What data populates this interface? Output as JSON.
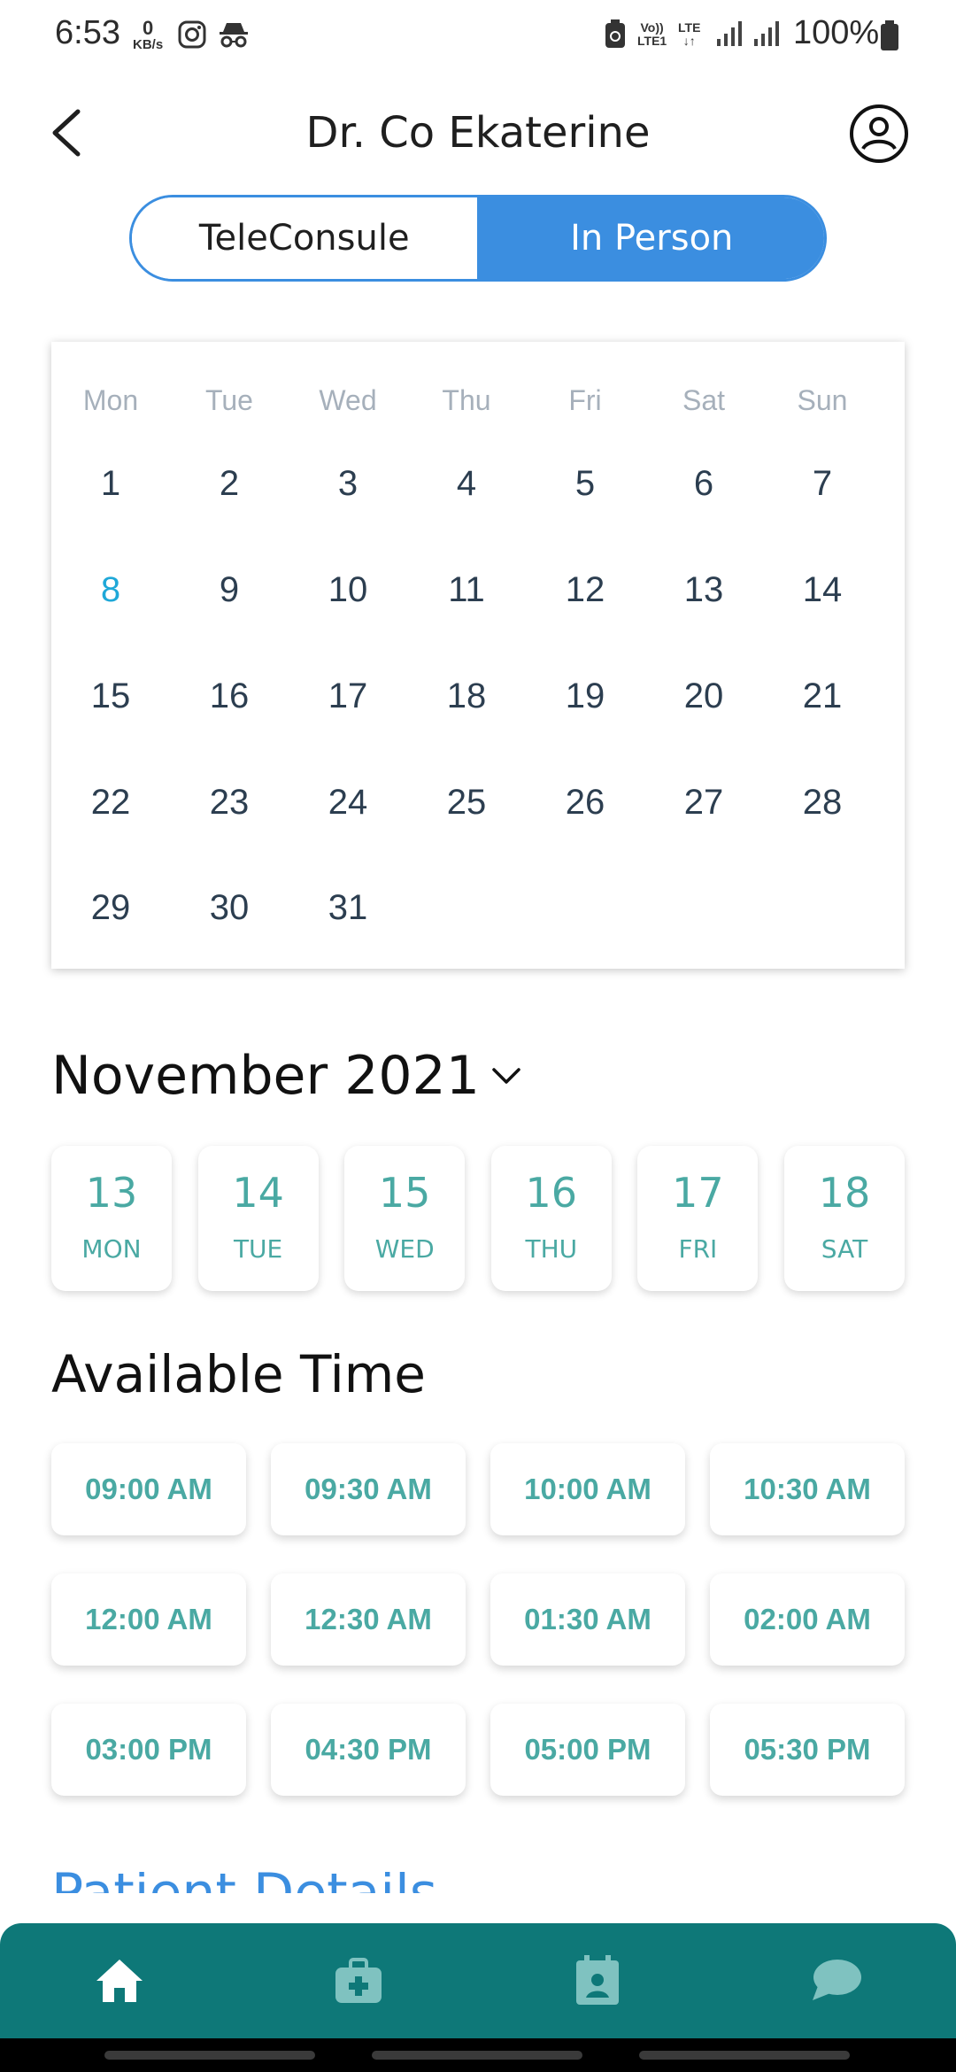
{
  "status_bar": {
    "time": "6:53",
    "kbs_value": "0",
    "kbs_unit": "KB/s",
    "volte": "Vo))",
    "lte1": "LTE1",
    "lte": "LTE",
    "battery": "100%"
  },
  "header": {
    "title": "Dr. Co Ekaterine",
    "back_icon": "chevron-left-icon",
    "profile_icon": "user-circle-icon"
  },
  "consult_toggle": {
    "options": [
      "TeleConsule",
      "In Person"
    ],
    "selected": "In Person"
  },
  "calendar": {
    "weekdays": [
      "Mon",
      "Tue",
      "Wed",
      "Thu",
      "Fri",
      "Sat",
      "Sun"
    ],
    "weeks": [
      [
        "1",
        "2",
        "3",
        "4",
        "5",
        "6",
        "7"
      ],
      [
        "8",
        "9",
        "10",
        "11",
        "12",
        "13",
        "14"
      ],
      [
        "15",
        "16",
        "17",
        "18",
        "19",
        "20",
        "21"
      ],
      [
        "22",
        "23",
        "24",
        "25",
        "26",
        "27",
        "28"
      ],
      [
        "29",
        "30",
        "31",
        "",
        "",
        "",
        ""
      ]
    ],
    "highlighted_day": "8",
    "highlight_color": "#1fa8d8"
  },
  "month_selector": {
    "label": "November 2021",
    "icon": "chevron-down-icon"
  },
  "week_strip": [
    {
      "day": "13",
      "dow": "MON"
    },
    {
      "day": "14",
      "dow": "TUE"
    },
    {
      "day": "15",
      "dow": "WED"
    },
    {
      "day": "16",
      "dow": "THU"
    },
    {
      "day": "17",
      "dow": "FRI"
    },
    {
      "day": "18",
      "dow": "SAT"
    }
  ],
  "available_time": {
    "title": "Available Time",
    "slots": [
      "09:00 AM",
      "09:30 AM",
      "10:00 AM",
      "10:30 AM",
      "12:00 AM",
      "12:30 AM",
      "01:30 AM",
      "02:00 AM",
      "03:00 PM",
      "04:30 PM",
      "05:00 PM",
      "05:30 PM"
    ]
  },
  "patient_details": {
    "title": "Patient Details"
  },
  "bottom_nav": {
    "items": [
      "home-icon",
      "medical-kit-icon",
      "calendar-contact-icon",
      "chat-bubble-icon"
    ],
    "background": "#0e7878"
  },
  "colors": {
    "accent_blue": "#3b8ee0",
    "teal_text": "#4aa9a3",
    "today_blue": "#1fa8d8"
  }
}
